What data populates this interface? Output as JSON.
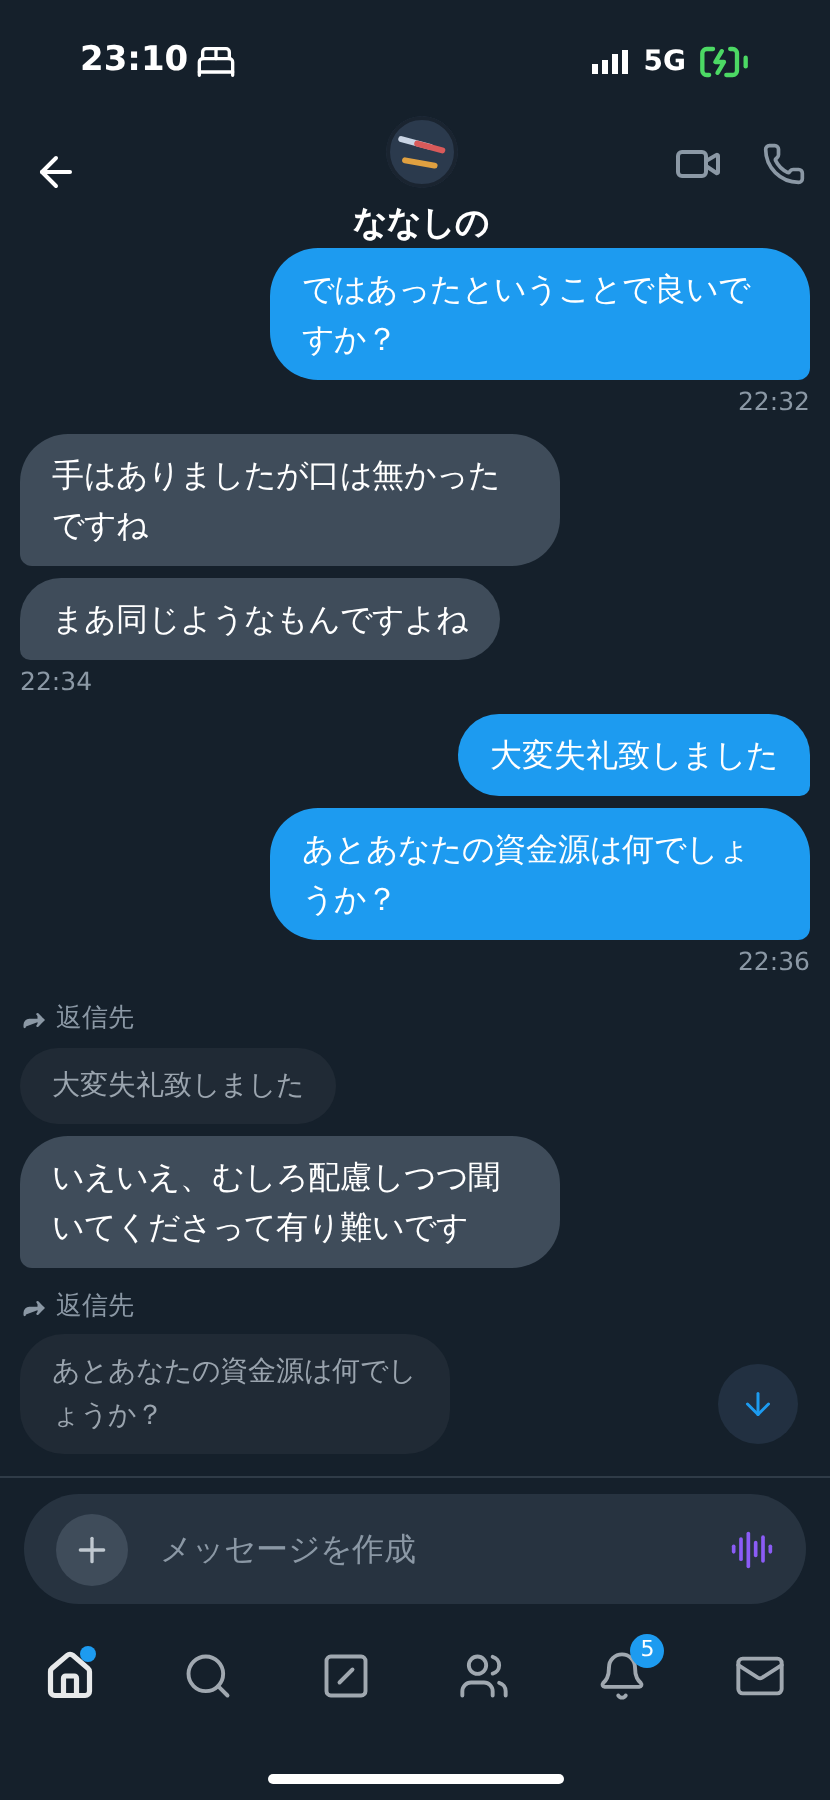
{
  "status_bar": {
    "time": "23:10",
    "network": "5G"
  },
  "header": {
    "name": "ななしの"
  },
  "messages": [
    {
      "kind": "sent",
      "text": "ではあったということで良いですか？",
      "time": "22:32"
    },
    {
      "kind": "received",
      "text": "手はありましたが口は無かったですね"
    },
    {
      "kind": "received",
      "text": "まあ同じようなもんですよね",
      "time": "22:34"
    },
    {
      "kind": "sent",
      "text": "大変失礼致しました"
    },
    {
      "kind": "sent",
      "text": "あとあなたの資金源は何でしょうか？",
      "time": "22:36"
    },
    {
      "kind": "received",
      "reply_label": "返信先",
      "quote": "大変失礼致しました",
      "text": "いえいえ、むしろ配慮しつつ聞いてくださって有り難いです"
    },
    {
      "kind": "received",
      "reply_label": "返信先",
      "quote": "あとあなたの資金源は何でしょうか？"
    }
  ],
  "composer": {
    "placeholder": "メッセージを作成"
  },
  "tabs": [
    {
      "selected": true,
      "dot": true
    },
    {
      "selected": false
    },
    {
      "selected": false
    },
    {
      "selected": false
    },
    {
      "selected": false,
      "badge": "5"
    },
    {
      "selected": false
    }
  ]
}
